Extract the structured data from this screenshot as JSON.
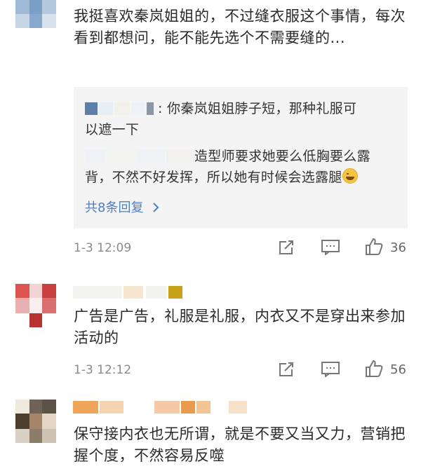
{
  "comments": [
    {
      "text": "我挺喜欢秦岚姐姐的，不过缝衣服这个事情，每次看到都想问，能不能先选个不需要缝的...",
      "replies": [
        {
          "text_line1": ": 你秦岚姐姐脖子短，那种礼服可",
          "text_line2": "以遮一下"
        },
        {
          "text_line1": "造型师要求她要么低胸要么露",
          "text_line2": "背，不然不好发挥，所以她有时候会选露腿"
        }
      ],
      "reply_count_label": "共8条回复",
      "timestamp": "1-3 12:09",
      "like_count": "36"
    },
    {
      "text": "广告是广告，礼服是礼服，内衣又不是穿出来参加活动的",
      "timestamp": "1-3 12:12",
      "like_count": "56"
    },
    {
      "text": "保守接内衣也无所谓，就是不要又当又力，营销把握个度，不然容易反噬"
    }
  ],
  "icons": {
    "share": "share-icon",
    "comment": "comment-icon",
    "like": "thumbs-up-icon",
    "chevron": "chevron-right-icon",
    "laugh_emoji": "laughing-emoji-icon"
  },
  "colors": {
    "link_blue": "#4e7ec2",
    "reply_bg": "#f4f4f4",
    "meta_gray": "#8a8a8a"
  }
}
